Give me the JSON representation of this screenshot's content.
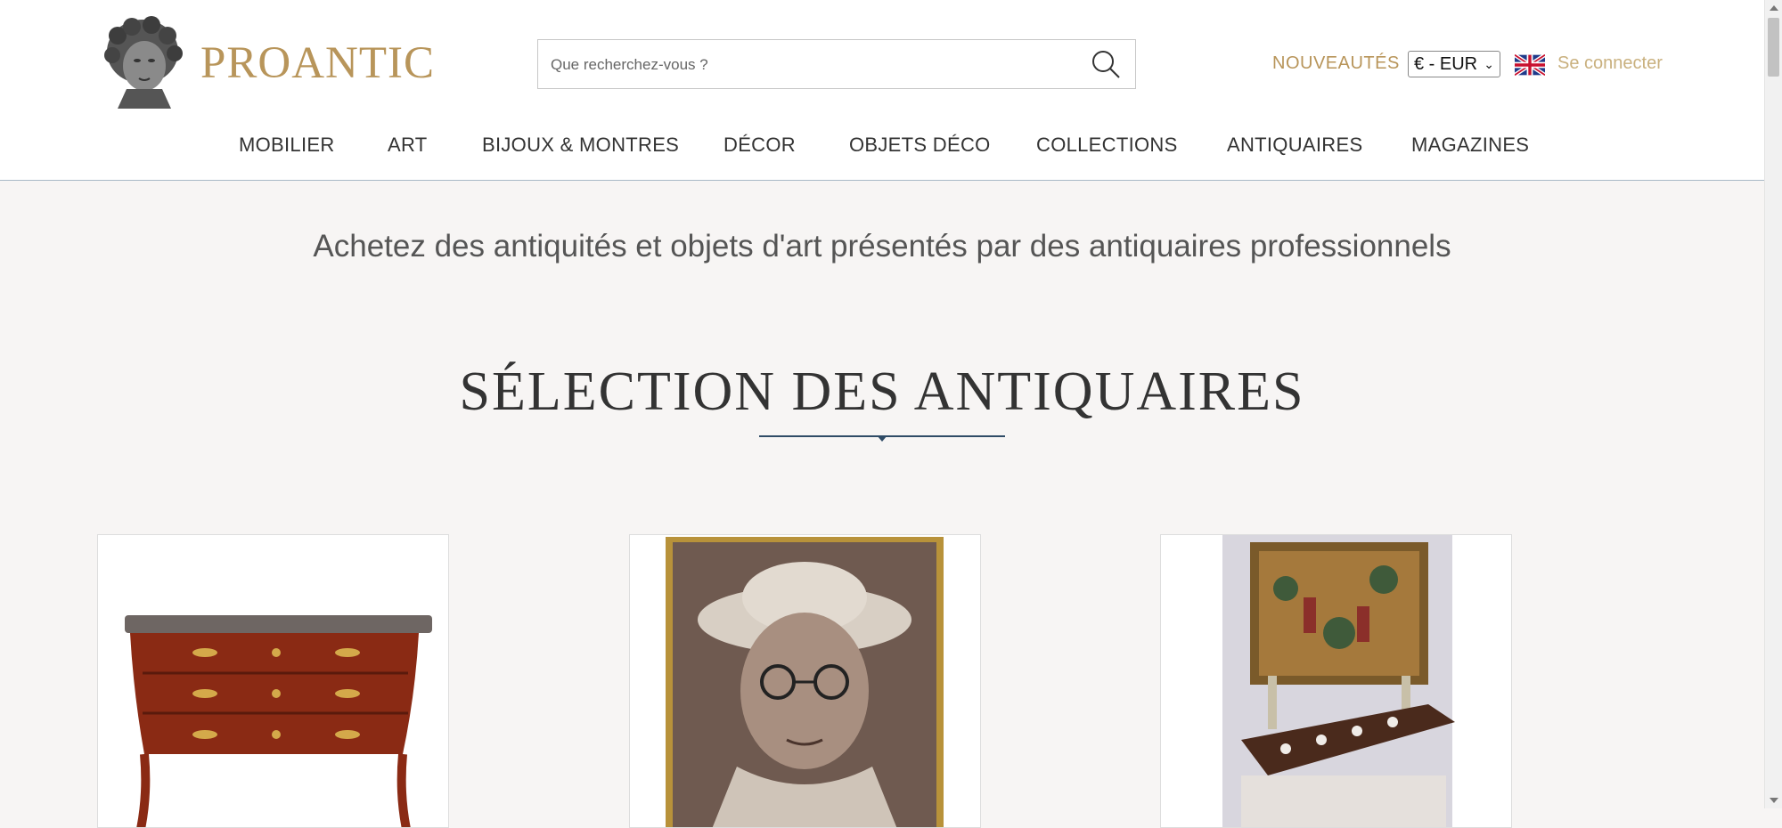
{
  "header": {
    "logo_text": "PROANTIC",
    "search": {
      "placeholder": "Que recherchez-vous ?"
    },
    "nouveautes": "NOUVEAUTÉS",
    "currency": "€ - EUR",
    "login": "Se connecter"
  },
  "nav": {
    "items": [
      "MOBILIER",
      "ART",
      "BIJOUX & MONTRES",
      "DÉCOR",
      "OBJETS DÉCO",
      "COLLECTIONS",
      "ANTIQUAIRES",
      "MAGAZINES"
    ]
  },
  "main": {
    "tagline": "Achetez des antiquités et objets d'art présentés par des antiquaires professionnels",
    "section_title": "SÉLECTION DES ANTIQUAIRES",
    "products": [
      {
        "name": "commode"
      },
      {
        "name": "portrait"
      },
      {
        "name": "dining-room-tapestry"
      }
    ]
  },
  "colors": {
    "accent": "#b8955a",
    "divider": "#2f4b66",
    "background": "#f7f5f4"
  }
}
